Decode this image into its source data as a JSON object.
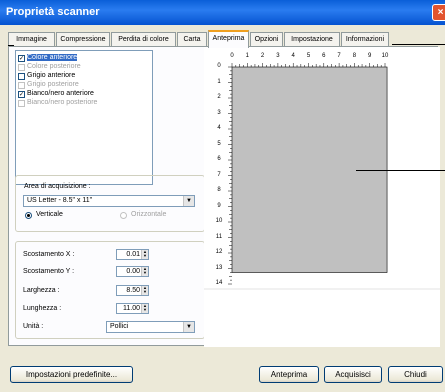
{
  "window": {
    "title": "Proprietà scanner",
    "close_glyph": "×"
  },
  "tabs": [
    "Immagine",
    "Compressione",
    "Perdita di colore",
    "Carta",
    "Anteprima",
    "Opzioni",
    "Impostazione",
    "Informazioni"
  ],
  "active_tab": "Anteprima",
  "image_list": [
    {
      "label": "Colore anteriore",
      "checked": true,
      "enabled": true,
      "selected": true
    },
    {
      "label": "Colore posteriore",
      "checked": false,
      "enabled": false,
      "selected": false
    },
    {
      "label": "Grigio anteriore",
      "checked": false,
      "enabled": true,
      "selected": false
    },
    {
      "label": "Grigio posteriore",
      "checked": false,
      "enabled": false,
      "selected": false
    },
    {
      "label": "Bianco/nero anteriore",
      "checked": true,
      "enabled": true,
      "selected": false
    },
    {
      "label": "Bianco/nero posteriore",
      "checked": false,
      "enabled": false,
      "selected": false
    }
  ],
  "area": {
    "label": "Area di acquisizione :",
    "value": "US Letter - 8.5\" x 11\"",
    "vertical_label": "Verticale",
    "horizontal_label": "Orizzontale",
    "vertical_selected": true
  },
  "fields": {
    "offset_x_label": "Scostamento X :",
    "offset_x_value": "0.01",
    "offset_y_label": "Scostamento Y :",
    "offset_y_value": "0.00",
    "width_label": "Larghezza :",
    "width_value": "8.50",
    "length_label": "Lunghezza :",
    "length_value": "11.00",
    "unit_label": "Unità :",
    "unit_value": "Pollici"
  },
  "preview": {
    "ruler_top": [
      "0",
      "1",
      "2",
      "3",
      "4",
      "5",
      "6",
      "7",
      "8",
      "9",
      "10"
    ],
    "ruler_left": [
      "0",
      "1",
      "2",
      "3",
      "4",
      "5",
      "6",
      "7",
      "8",
      "9",
      "10",
      "11",
      "12",
      "13",
      "14"
    ],
    "page_width_in": 8.5,
    "page_length_in": 11
  },
  "buttons": {
    "defaults": "Impostazioni predefinite...",
    "preview": "Anteprima",
    "acquire": "Acquisisci",
    "close": "Chiudi"
  }
}
